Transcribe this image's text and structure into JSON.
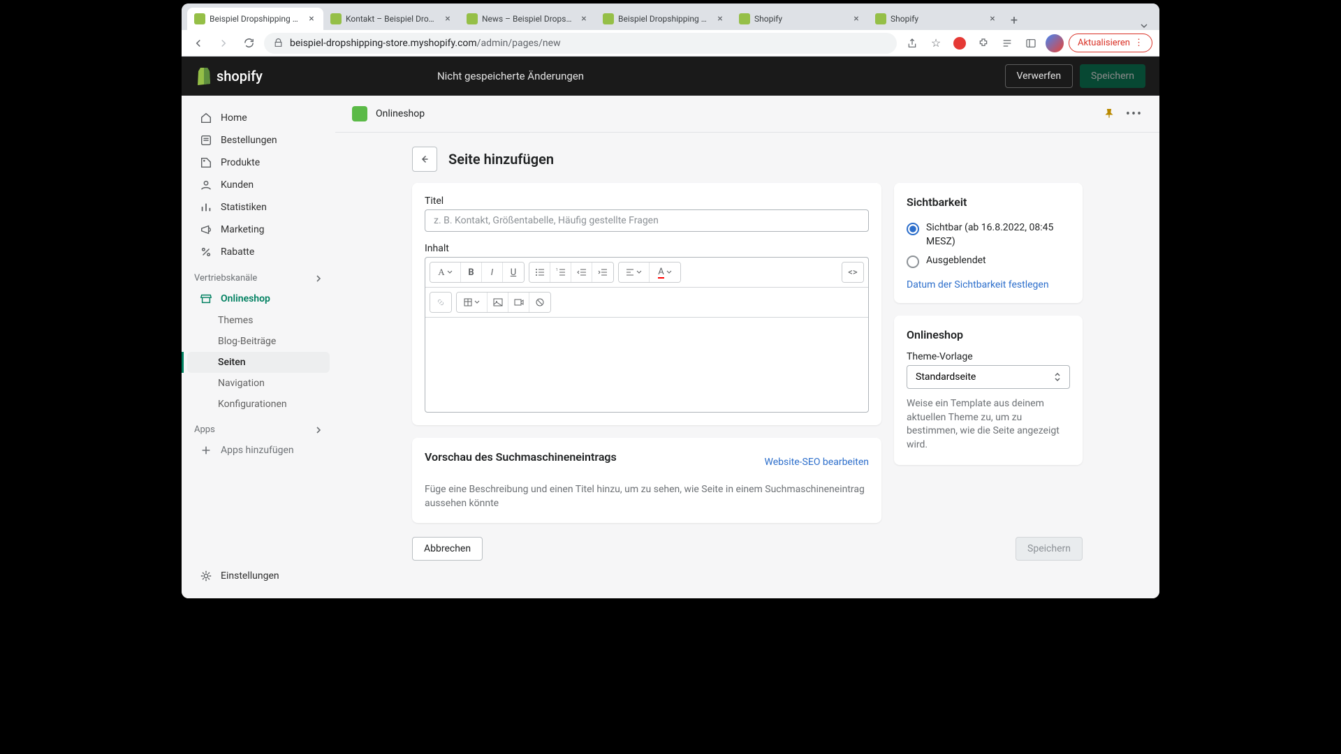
{
  "browser": {
    "tabs": [
      {
        "title": "Beispiel Dropshipping Stor",
        "favicon": "shopify-green"
      },
      {
        "title": "Kontakt – Beispiel Dropshi",
        "favicon": "shopify-green"
      },
      {
        "title": "News – Beispiel Dropshipp",
        "favicon": "shopify-green"
      },
      {
        "title": "Beispiel Dropshipping Stor",
        "favicon": "shopify-green"
      },
      {
        "title": "Shopify",
        "favicon": "shopify-green"
      },
      {
        "title": "Shopify",
        "favicon": "shopify-green"
      }
    ],
    "url_domain": "beispiel-dropshipping-store.myshopify.com",
    "url_path": "/admin/pages/new",
    "update_label": "Aktualisieren"
  },
  "topbar": {
    "brand": "shopify",
    "unsaved_message": "Nicht gespeicherte Änderungen",
    "discard_label": "Verwerfen",
    "save_label": "Speichern"
  },
  "sidebar": {
    "home": "Home",
    "orders": "Bestellungen",
    "products": "Produkte",
    "customers": "Kunden",
    "analytics": "Statistiken",
    "marketing": "Marketing",
    "discounts": "Rabatte",
    "channels_label": "Vertriebskanäle",
    "onlineshop": "Onlineshop",
    "themes": "Themes",
    "blogs": "Blog-Beiträge",
    "pages": "Seiten",
    "navigation": "Navigation",
    "preferences": "Konfigurationen",
    "apps_label": "Apps",
    "add_apps": "Apps hinzufügen",
    "settings": "Einstellungen"
  },
  "main_header": {
    "title": "Onlineshop"
  },
  "page": {
    "title": "Seite hinzufügen",
    "title_label": "Titel",
    "title_placeholder": "z. B. Kontakt, Größentabelle, Häufig gestellte Fragen",
    "content_label": "Inhalt"
  },
  "seo": {
    "heading": "Vorschau des Suchmaschineneintrags",
    "edit_link": "Website-SEO bearbeiten",
    "description": "Füge eine Beschreibung und einen Titel hinzu, um zu sehen, wie Seite in einem Suchmaschineneintrag aussehen könnte"
  },
  "visibility": {
    "heading": "Sichtbarkeit",
    "visible_label": "Sichtbar (ab 16.8.2022, 08:45 MESZ)",
    "hidden_label": "Ausgeblendet",
    "set_date_link": "Datum der Sichtbarkeit festlegen"
  },
  "onlineshop_card": {
    "heading": "Onlineshop",
    "template_label": "Theme-Vorlage",
    "template_value": "Standardseite",
    "help_text": "Weise ein Template aus deinem aktuellen Theme zu, um zu bestimmen, wie die Seite angezeigt wird."
  },
  "footer": {
    "cancel": "Abbrechen",
    "save": "Speichern"
  }
}
